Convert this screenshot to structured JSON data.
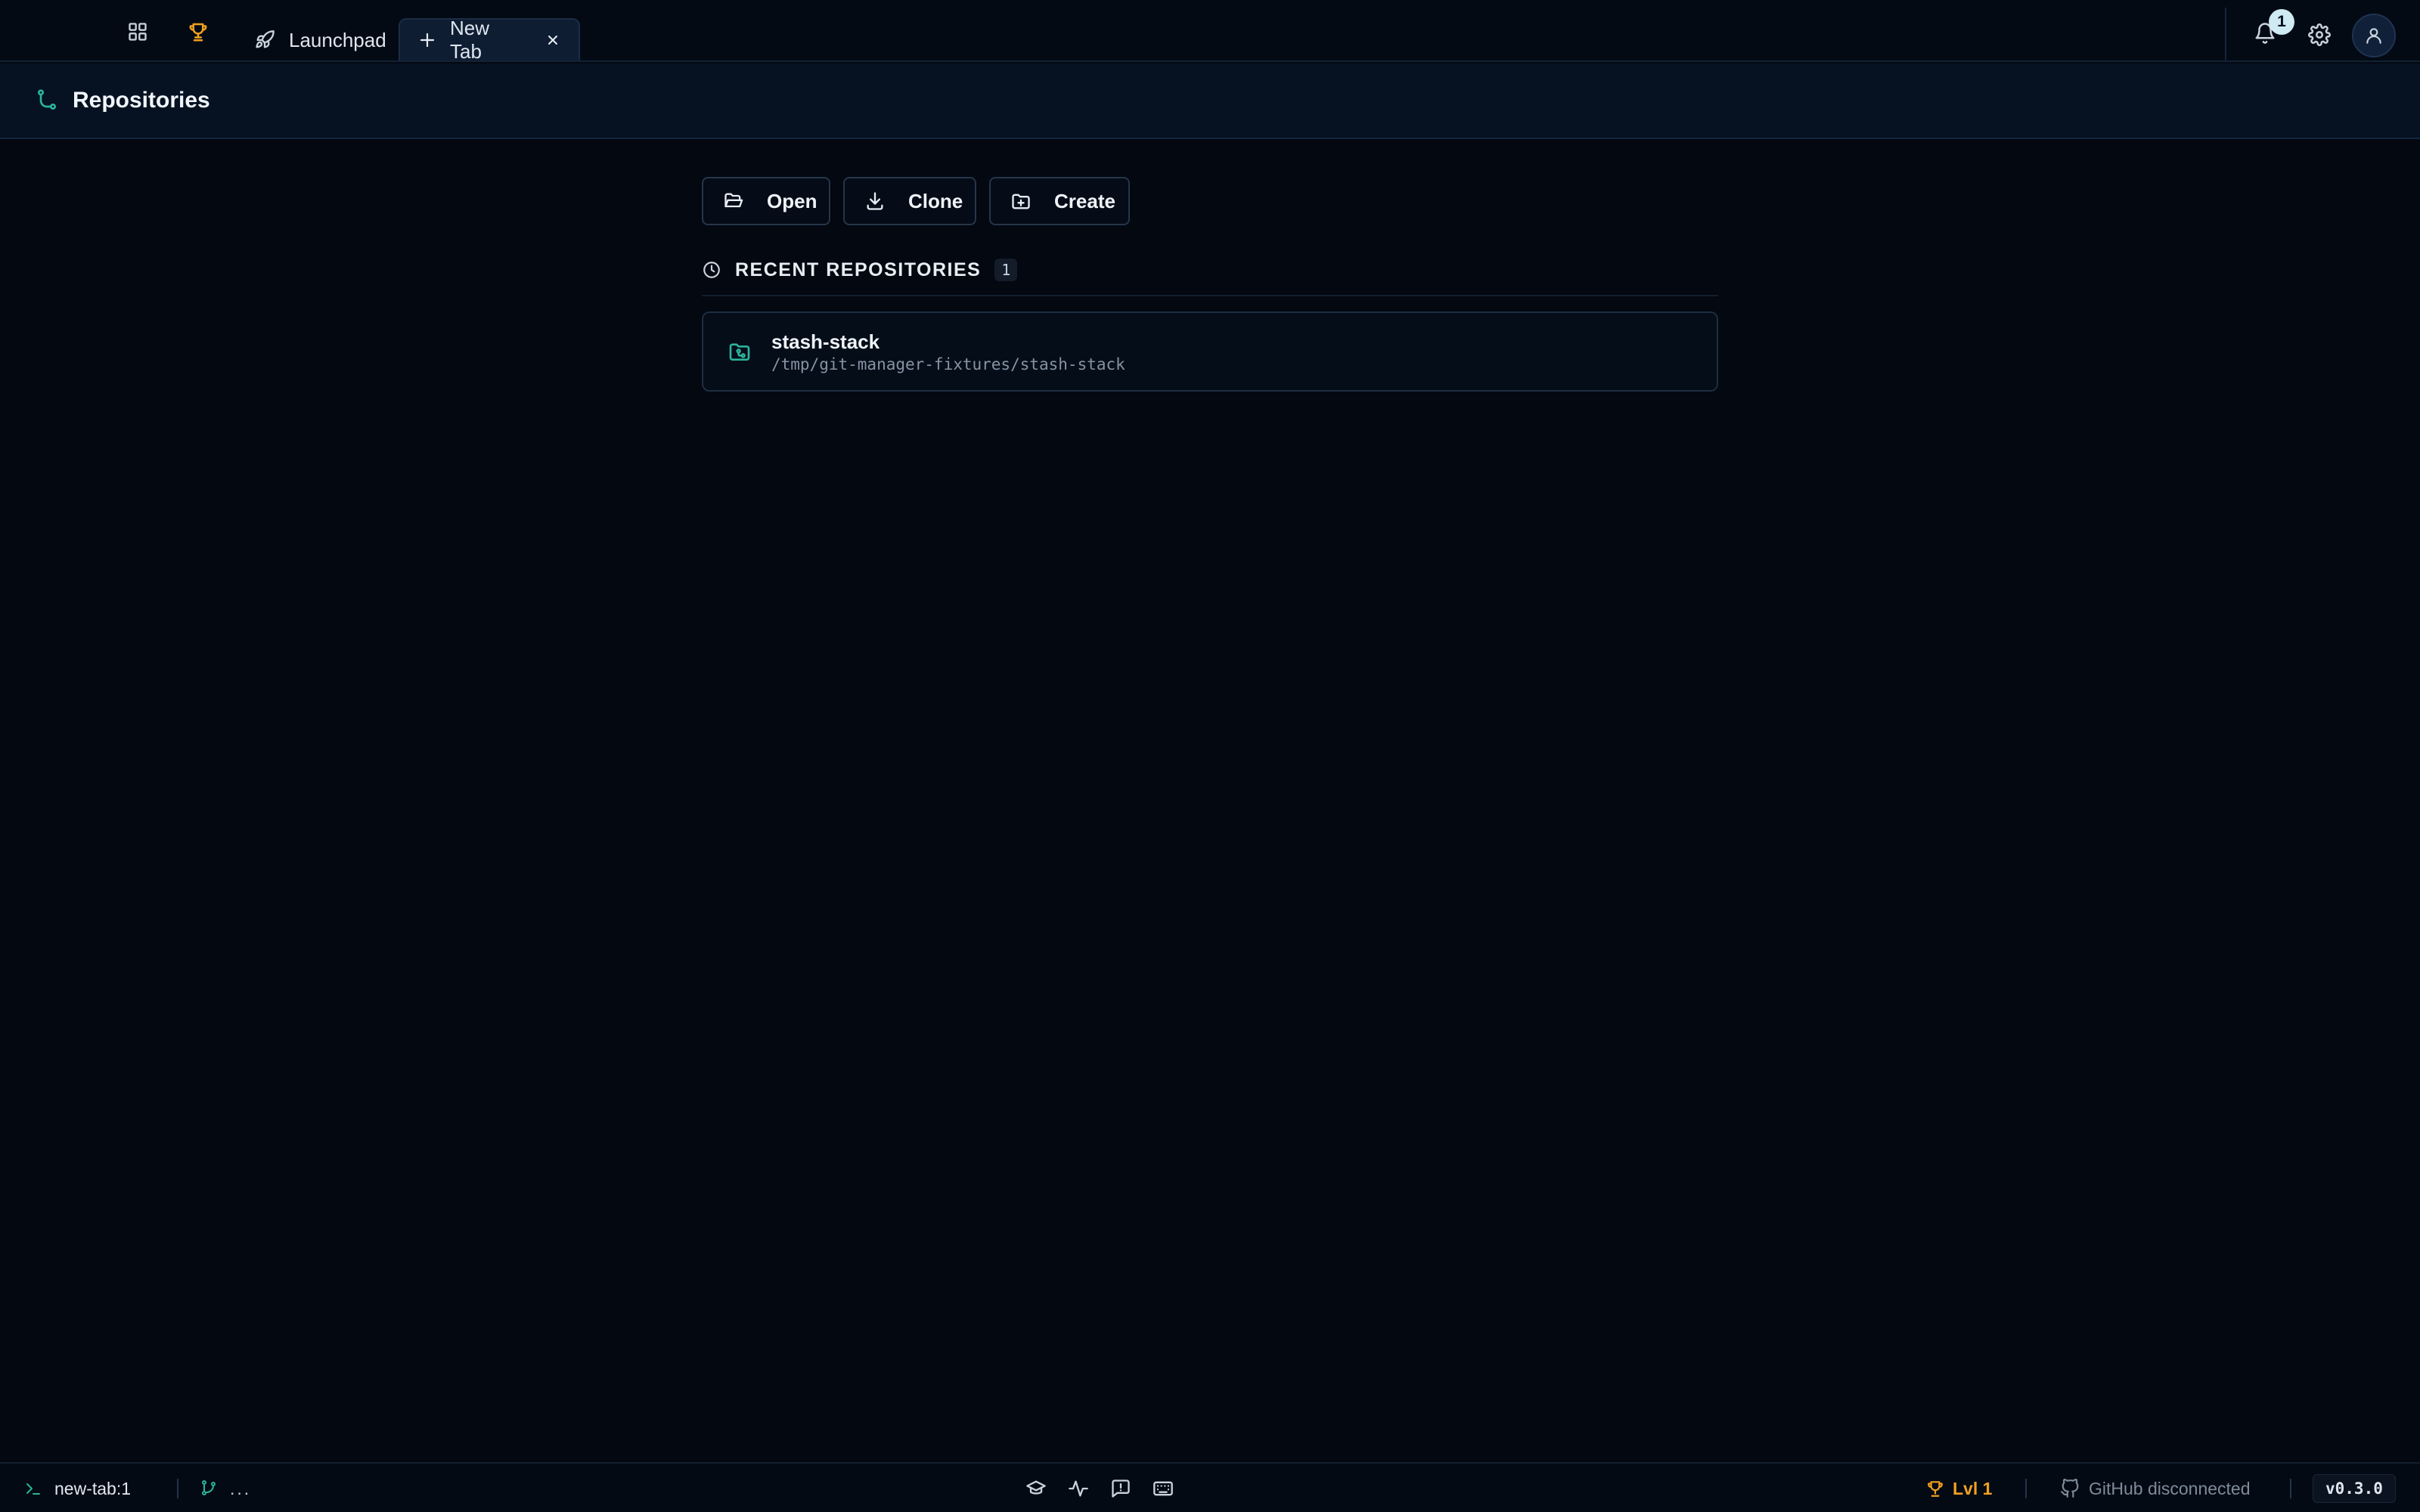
{
  "tabs": {
    "launchpad": "Launchpad",
    "active": "New Tab"
  },
  "notifications": {
    "count": "1"
  },
  "header": {
    "title": "Repositories"
  },
  "actions": {
    "open": "Open",
    "clone": "Clone",
    "create": "Create"
  },
  "recent": {
    "title": "RECENT REPOSITORIES",
    "count": "1",
    "items": [
      {
        "name": "stash-stack",
        "path": "/tmp/git-manager-fixtures/stash-stack"
      }
    ]
  },
  "statusbar": {
    "terminal": "new-tab:1",
    "branch": "...",
    "level": "Lvl 1",
    "github": "GitHub disconnected",
    "version": "v0.3.0"
  },
  "colors": {
    "accent_teal": "#2bb39a",
    "trophy_orange": "#f0a020",
    "background": "#030811"
  },
  "icons": [
    "grid-icon",
    "trophy-icon",
    "rocket-icon",
    "plus-icon",
    "close-icon",
    "bell-icon",
    "gear-icon",
    "user-icon",
    "git-branch-icon",
    "folder-open-icon",
    "download-icon",
    "folder-plus-icon",
    "clock-icon",
    "folder-git-icon",
    "terminal-icon",
    "graduation-cap-icon",
    "activity-icon",
    "feedback-icon",
    "keyboard-icon",
    "github-icon"
  ]
}
